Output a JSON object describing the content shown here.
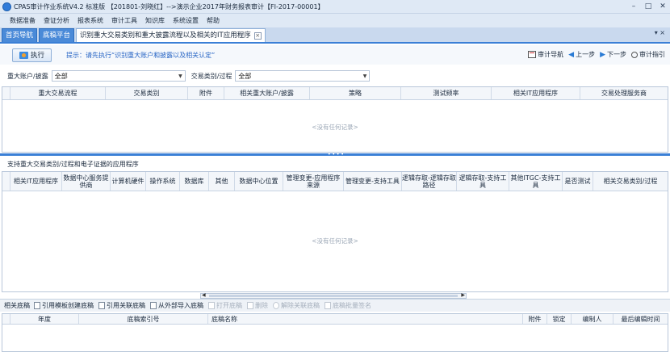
{
  "window": {
    "title": "CPAS审计作业系统V4.2 标准版 【201801-刘晓红】-->演示企业2017年财务报表审计【FI-2017-00001】",
    "controls": [
      "–",
      "□",
      "✕"
    ]
  },
  "menu": [
    "数据准备",
    "查证分析",
    "报表系统",
    "审计工具",
    "知识库",
    "系统设置",
    "帮助"
  ],
  "tabs": {
    "items": [
      "首页导航",
      "底稿平台"
    ],
    "active": "识别重大交易类别和重大披露流程以及相关的IT应用程序",
    "extra": "▾ ×"
  },
  "toolbar": {
    "execute_label": "执行",
    "hint": "提示：请先执行“识别重大账户和披露以及相关认定”",
    "audit_nav": "审计导航",
    "prev": "上一步",
    "next": "下一步",
    "guide": "审计指引"
  },
  "filters": {
    "account_label": "重大账户/披露",
    "account_value": "全部",
    "txn_label": "交易类别/过程",
    "txn_value": "全部"
  },
  "grid1": {
    "columns": [
      "重大交易流程",
      "交易类别",
      "附件",
      "相关重大账户/披露",
      "策略",
      "测试频率",
      "相关IT应用程序",
      "交易处理服务商"
    ],
    "empty": "<没有任何记录>"
  },
  "section2": {
    "title": "支持重大交易类别/过程和电子证据的应用程序"
  },
  "grid2": {
    "columns": [
      "相关IT应用程序",
      "数据中心服务提供商",
      "计算机硬件",
      "操作系统",
      "数据库",
      "其他",
      "数据中心位置",
      "管理变更-应用程序来源",
      "管理变更-支持工具",
      "逻辑存取-逻辑存取路径",
      "逻辑存取-支持工具",
      "其他ITGC-支持工具",
      "是否测试",
      "相关交易类别/过程"
    ],
    "empty": "<没有任何记录>"
  },
  "docbar": {
    "label": "相关底稿",
    "buttons": [
      {
        "label": "引用模板创建底稿",
        "enabled": true
      },
      {
        "label": "引用关联底稿",
        "enabled": true
      },
      {
        "label": "从外部导入底稿",
        "enabled": true
      },
      {
        "label": "打开底稿",
        "enabled": false
      },
      {
        "label": "删除",
        "enabled": false
      },
      {
        "label": "解除关联底稿",
        "enabled": false
      },
      {
        "label": "底稿批量签名",
        "enabled": false
      }
    ]
  },
  "grid3": {
    "columns": [
      "年度",
      "底稿索引号",
      "底稿名称",
      "附件",
      "锁定",
      "编制人",
      "最后编辑时间"
    ]
  },
  "colors": {
    "accent": "#3a7fd6",
    "tab_bg": "#4a8ad8",
    "hint_text": "#2563c4",
    "empty_text": "#9aa6b5"
  }
}
